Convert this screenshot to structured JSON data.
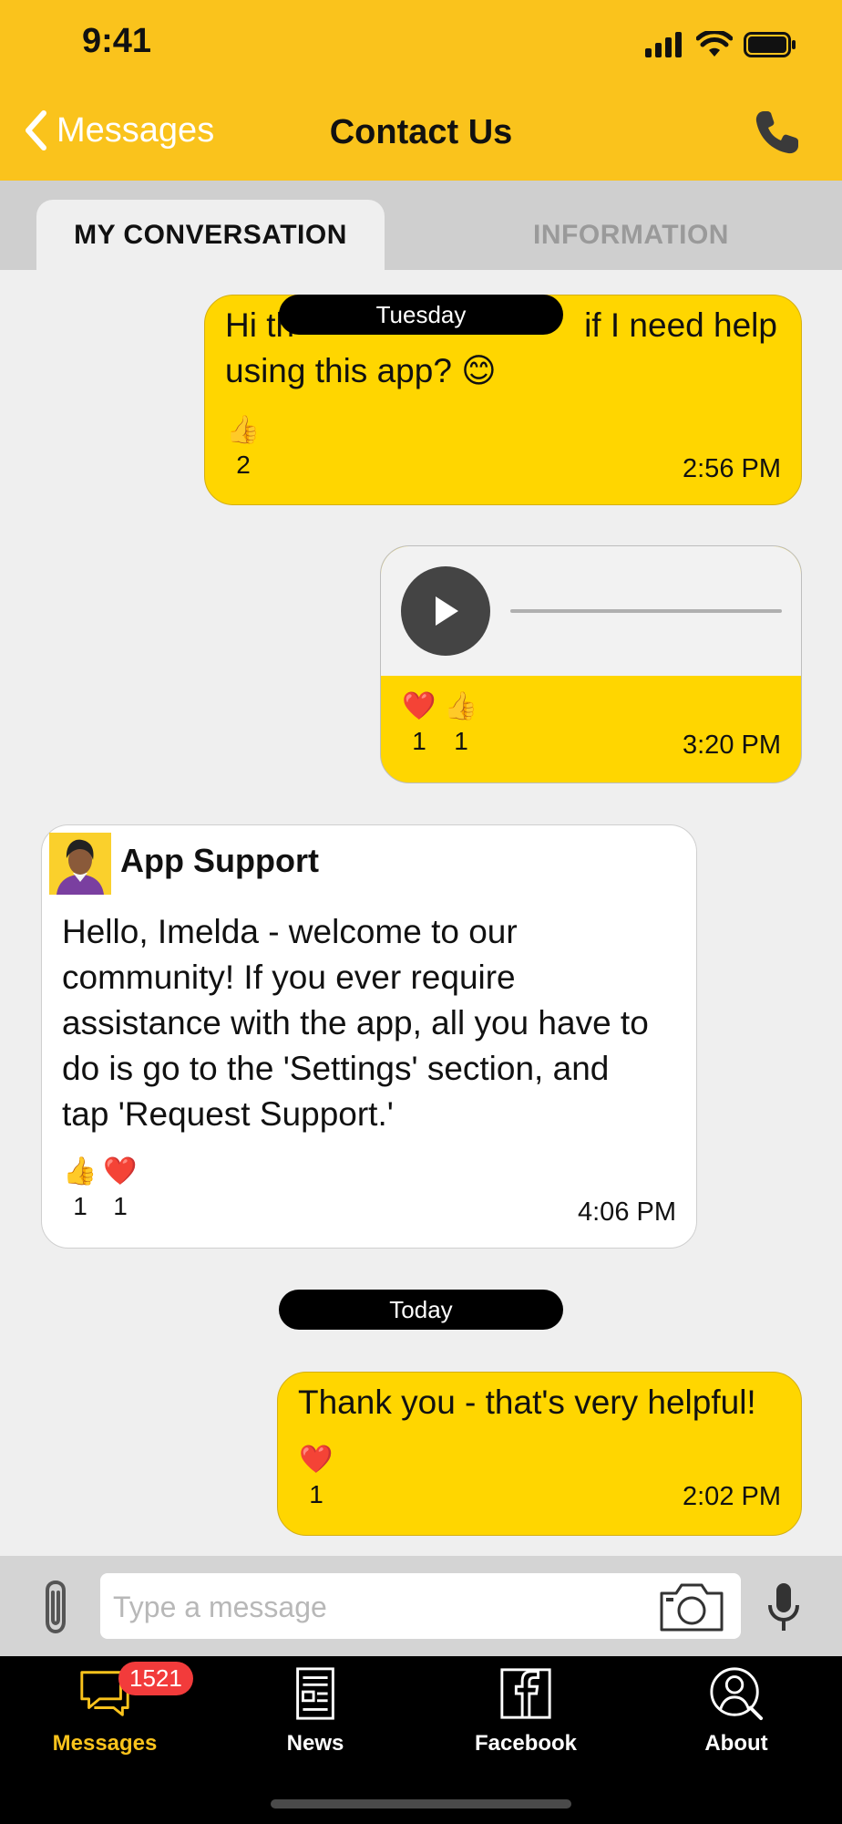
{
  "status_bar": {
    "time": "9:41"
  },
  "header": {
    "back_label": "Messages",
    "title": "Contact Us"
  },
  "tabs": {
    "active": "MY CONVERSATION",
    "inactive": "INFORMATION"
  },
  "messages": [
    {
      "type": "outgoing",
      "text": "Hi th… … if I need help using this app? 😊",
      "line1_left": "Hi th",
      "line1_right": "if I need help",
      "line2": "using this app? 😊",
      "date_overlay": "Tuesday",
      "reactions": [
        {
          "emoji": "👍",
          "count": "2"
        }
      ],
      "time": "2:56 PM"
    },
    {
      "type": "outgoing-audio",
      "reactions": [
        {
          "emoji": "❤️",
          "count": "1"
        },
        {
          "emoji": "👍",
          "count": "1"
        }
      ],
      "time": "3:20 PM"
    },
    {
      "type": "incoming",
      "sender": "App Support",
      "lines": [
        "Hello, Imelda - welcome to our",
        "community! If you ever require",
        "assistance with the app, all you have to",
        "do is go to the 'Settings' section, and",
        "tap 'Request Support.'"
      ],
      "reactions": [
        {
          "emoji": "👍",
          "count": "1"
        },
        {
          "emoji": "❤️",
          "count": "1"
        }
      ],
      "time": "4:06 PM"
    },
    {
      "type": "date",
      "label": "Today"
    },
    {
      "type": "outgoing",
      "text": "Thank you - that's very helpful!",
      "reactions": [
        {
          "emoji": "❤️",
          "count": "1"
        }
      ],
      "time": "2:02 PM"
    }
  ],
  "composer": {
    "placeholder": "Type a message"
  },
  "tabbar": {
    "items": [
      {
        "label": "Messages",
        "badge": "1521",
        "active": true
      },
      {
        "label": "News"
      },
      {
        "label": "Facebook"
      },
      {
        "label": "About"
      }
    ],
    "active_color": "#fac31c"
  },
  "colors": {
    "header": "#fac31c",
    "bubble_out": "#ffd600",
    "badge": "#f23b3b"
  }
}
